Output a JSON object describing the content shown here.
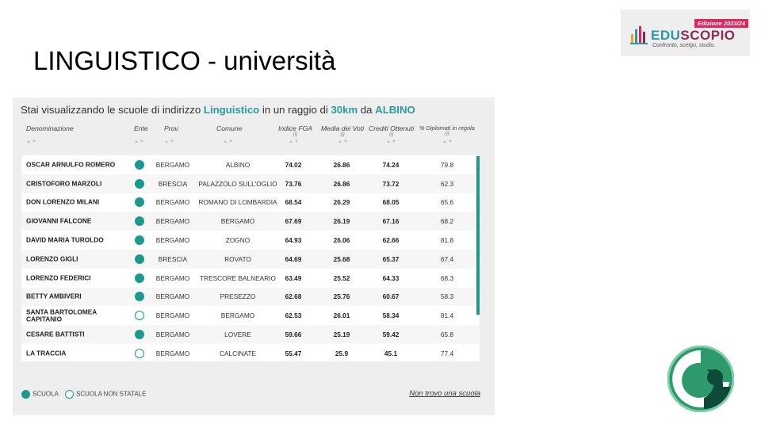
{
  "slide": {
    "title": "LINGUISTICO - università"
  },
  "logo": {
    "edition": "Edizione 2023/24",
    "brand_a": "EDU",
    "brand_b": "SCOPIO",
    "tagline": "Confronto, scelgo, studio."
  },
  "panel": {
    "heading_prefix": "Stai visualizzando le scuole di indirizzo ",
    "heading_indirizzo": "Linguistico",
    "heading_mid": " in un raggio di ",
    "heading_km": "30km",
    "heading_da": " da ",
    "heading_city": "ALBINO"
  },
  "columns": {
    "denominazione": "Denominazione",
    "ente": "Ente",
    "prov": "Prov.",
    "comune": "Comune",
    "fga": "Indice FGA",
    "voti": "Media dei Voti",
    "crediti": "Crediti Ottenuti",
    "diplomati": "% Diplomati in regola",
    "info": "(i)"
  },
  "rows": [
    {
      "name": "OSCAR ARNULFO ROMERO",
      "ente": "full",
      "prov": "BERGAMO",
      "comune": "ALBINO",
      "fga": "74.02",
      "voti": "26.86",
      "crediti": "74.24",
      "dipl": "79.8"
    },
    {
      "name": "CRISTOFORO MARZOLI",
      "ente": "full",
      "prov": "BRESCIA",
      "comune": "PALAZZOLO SULL'OGLIO",
      "fga": "73.76",
      "voti": "26.86",
      "crediti": "73.72",
      "dipl": "62.3"
    },
    {
      "name": "DON LORENZO MILANI",
      "ente": "full",
      "prov": "BERGAMO",
      "comune": "ROMANO DI LOMBARDIA",
      "fga": "68.54",
      "voti": "26.29",
      "crediti": "68.05",
      "dipl": "65.6"
    },
    {
      "name": "GIOVANNI FALCONE",
      "ente": "full",
      "prov": "BERGAMO",
      "comune": "BERGAMO",
      "fga": "67.69",
      "voti": "26.19",
      "crediti": "67.16",
      "dipl": "68.2"
    },
    {
      "name": "DAVID MARIA TUROLDO",
      "ente": "full",
      "prov": "BERGAMO",
      "comune": "ZOGNO",
      "fga": "64.93",
      "voti": "26.06",
      "crediti": "62.66",
      "dipl": "81.8"
    },
    {
      "name": "LORENZO GIGLI",
      "ente": "full",
      "prov": "BRESCIA",
      "comune": "ROVATO",
      "fga": "64.69",
      "voti": "25.68",
      "crediti": "65.37",
      "dipl": "67.4"
    },
    {
      "name": "LORENZO FEDERICI",
      "ente": "full",
      "prov": "BERGAMO",
      "comune": "TRESCORE BALNEARIO",
      "fga": "63.49",
      "voti": "25.52",
      "crediti": "64.33",
      "dipl": "68.3"
    },
    {
      "name": "BETTY AMBIVERI",
      "ente": "full",
      "prov": "BERGAMO",
      "comune": "PRESEZZO",
      "fga": "62.68",
      "voti": "25.76",
      "crediti": "60.67",
      "dipl": "58.3"
    },
    {
      "name": "SANTA BARTOLOMEA CAPITANIO",
      "ente": "empty",
      "prov": "BERGAMO",
      "comune": "BERGAMO",
      "fga": "62.53",
      "voti": "26.01",
      "crediti": "58.34",
      "dipl": "81.4"
    },
    {
      "name": "CESARE BATTISTI",
      "ente": "full",
      "prov": "BERGAMO",
      "comune": "LOVERE",
      "fga": "59.66",
      "voti": "25.19",
      "crediti": "59.42",
      "dipl": "65.8"
    },
    {
      "name": "LA TRACCIA",
      "ente": "empty",
      "prov": "BERGAMO",
      "comune": "CALCINATE",
      "fga": "55.47",
      "voti": "25.9",
      "crediti": "45.1",
      "dipl": "77.4"
    }
  ],
  "legend": {
    "scuola": "SCUOLA",
    "non_statale": "SCUOLA NON STATALE"
  },
  "actions": {
    "not_found": "Non trovo una scuola"
  },
  "colors": {
    "teal": "#1a9a8e",
    "accent": "#2a9aa0",
    "brand_dark": "#8a2a55",
    "edition_bg": "#e0245e"
  }
}
